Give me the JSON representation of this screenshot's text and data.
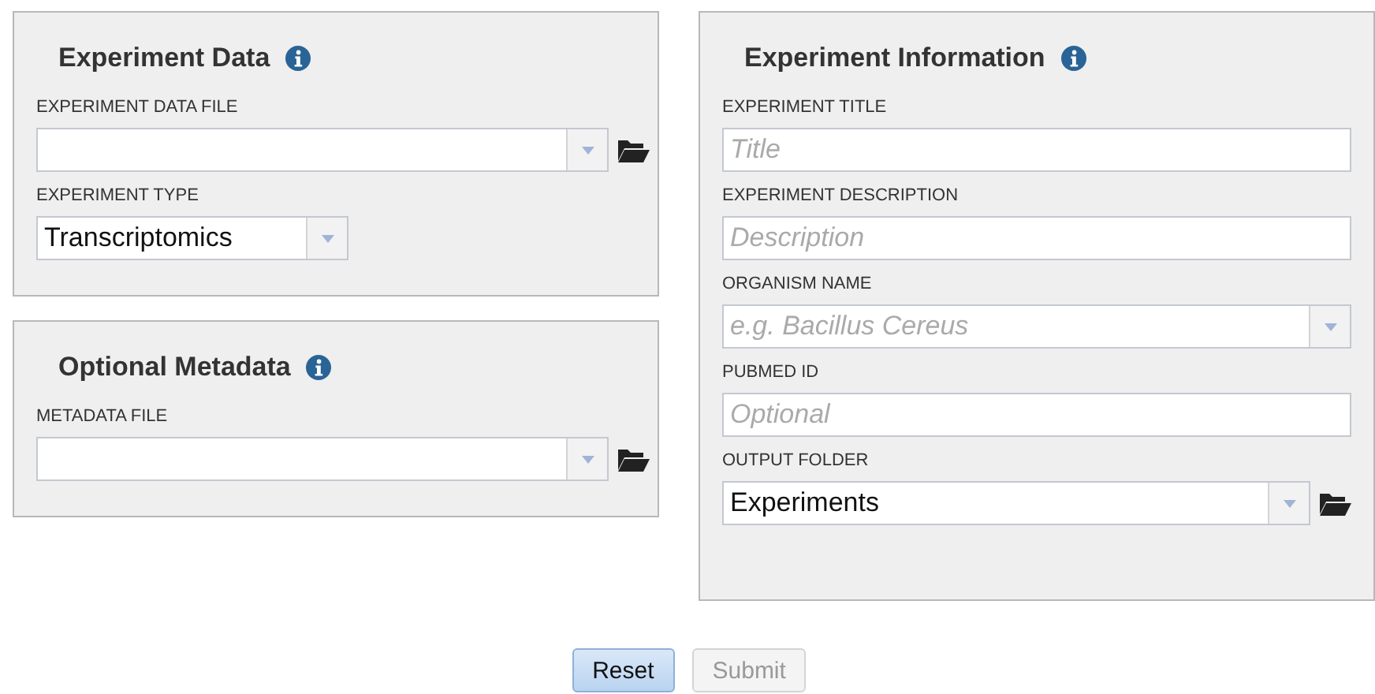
{
  "left_panels": [
    {
      "title": "Experiment Data",
      "fields": [
        {
          "kind": "select",
          "label": "EXPERIMENT DATA FILE",
          "browse": true,
          "compact": false
        },
        {
          "kind": "select",
          "label": "EXPERIMENT TYPE",
          "value": "Transcriptomics",
          "browse": false,
          "compact": true
        }
      ]
    },
    {
      "title": "Optional Metadata",
      "fields": [
        {
          "kind": "select",
          "label": "METADATA FILE",
          "browse": true,
          "compact": false
        }
      ]
    }
  ],
  "right_panel": {
    "title": "Experiment Information",
    "fields": [
      {
        "kind": "text",
        "label": "EXPERIMENT TITLE",
        "placeholder": "Title",
        "browse": false,
        "compact": false
      },
      {
        "kind": "text",
        "label": "EXPERIMENT DESCRIPTION",
        "placeholder": "Description",
        "browse": false,
        "compact": false
      },
      {
        "kind": "select",
        "label": "ORGANISM NAME",
        "placeholder": "e.g. Bacillus Cereus",
        "browse": false,
        "compact": false
      },
      {
        "kind": "text",
        "label": "PUBMED ID",
        "placeholder": "Optional",
        "browse": false,
        "compact": false
      },
      {
        "kind": "select",
        "label": "OUTPUT FOLDER",
        "value": "Experiments",
        "browse": true,
        "compact": false
      }
    ]
  },
  "buttons": [
    {
      "label": "Reset",
      "disabled": false
    },
    {
      "label": "Submit",
      "disabled": true
    }
  ]
}
